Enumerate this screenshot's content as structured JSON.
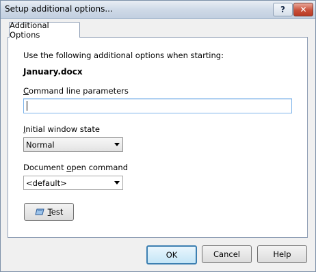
{
  "window": {
    "title": "Setup additional options..."
  },
  "titlebar": {
    "help_glyph": "?",
    "close_glyph": "✕"
  },
  "tabs": [
    {
      "label": "Additional Options",
      "active": true
    }
  ],
  "content": {
    "intro": "Use the following additional options when starting:",
    "filename": "January.docx",
    "cmd_label_accel": "C",
    "cmd_label_rest": "ommand line parameters",
    "cmd_value": "",
    "iws_label_accel": "I",
    "iws_label_rest": "nitial window state",
    "iws_value": "Normal",
    "doc_label_pre": "Document ",
    "doc_label_accel": "o",
    "doc_label_rest": "pen command",
    "doc_value": "<default>",
    "test_accel": "T",
    "test_rest": "est"
  },
  "buttons": {
    "ok": "OK",
    "cancel": "Cancel",
    "help": "Help"
  },
  "icons": {
    "test": "eraser-icon",
    "help": "help-icon",
    "close": "close-icon",
    "dropdown": "chevron-down-icon"
  }
}
